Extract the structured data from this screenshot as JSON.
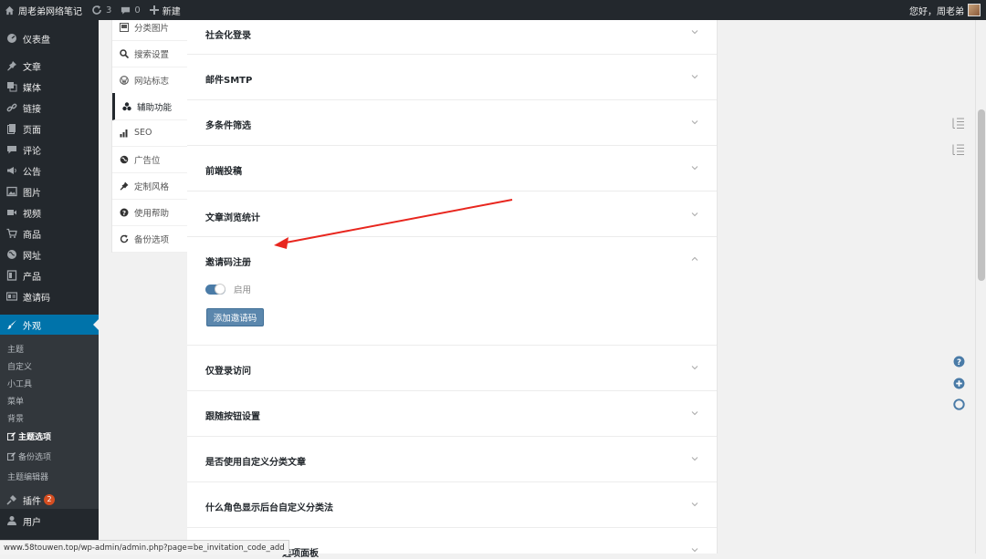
{
  "adminbar": {
    "site_name": "周老弟网络笔记",
    "updates_count": "3",
    "comments_count": "0",
    "new_label": "新建",
    "greeting": "您好，周老弟"
  },
  "menu": {
    "dashboard": "仪表盘",
    "posts": "文章",
    "media": "媒体",
    "links": "链接",
    "pages": "页面",
    "comments": "评论",
    "notice": "公告",
    "pictures": "图片",
    "videos": "视频",
    "goods": "商品",
    "sites": "网址",
    "products": "产品",
    "invite_code": "邀请码",
    "appearance": "外观",
    "plugins": "插件",
    "plugins_badge": "2",
    "users": "用户"
  },
  "submenu": {
    "themes": "主题",
    "customize": "自定义",
    "widgets": "小工具",
    "menus": "菜单",
    "background": "背景",
    "theme_options": "主题选项",
    "backup_options": "备份选项",
    "theme_editor": "主题编辑器"
  },
  "option_tabs": [
    {
      "label": "分类图片"
    },
    {
      "label": "搜索设置"
    },
    {
      "label": "网站标志"
    },
    {
      "label": "辅助功能"
    },
    {
      "label": "SEO"
    },
    {
      "label": "广告位"
    },
    {
      "label": "定制风格"
    },
    {
      "label": "使用帮助"
    },
    {
      "label": "备份选项"
    }
  ],
  "accordion": {
    "social_login": "社会化登录",
    "smtp": "邮件SMTP",
    "multi_filter": "多条件筛选",
    "frontend_post": "前端投稿",
    "view_stats": "文章浏览统计",
    "invite_register": "邀请码注册",
    "enable_label": "启用",
    "add_code_button": "添加邀请码",
    "login_only": "仅登录访问",
    "follow_button": "跟随按钮设置",
    "custom_taxonomy": "是否使用自定义分类文章",
    "role_taxonomy": "什么角色显示后台自定义分类法",
    "options_panel_partial": "选项面板"
  },
  "status_url": "www.58touwen.top/wp-admin/admin.php?page=be_invitation_code_add",
  "colors": {
    "admin_dark": "#23282d",
    "accent_blue": "#0073aa",
    "button_blue": "#5b87ad",
    "arrow_red": "#e8261e"
  }
}
